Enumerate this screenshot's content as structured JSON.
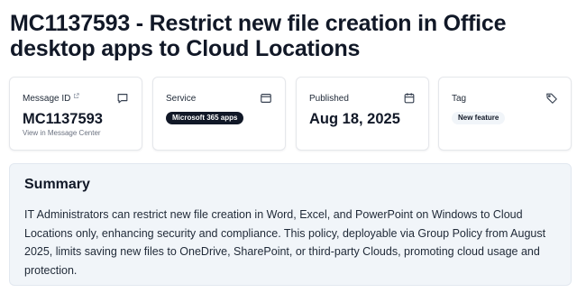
{
  "page": {
    "title": "MC1137593 - Restrict new file creation in Office desktop apps to Cloud Locations"
  },
  "cards": {
    "message_id": {
      "label": "Message ID",
      "value": "MC1137593",
      "link": "View in Message Center",
      "icon": "message-icon"
    },
    "service": {
      "label": "Service",
      "badge": "Microsoft 365 apps",
      "icon": "window-icon"
    },
    "published": {
      "label": "Published",
      "value": "Aug 18, 2025",
      "icon": "calendar-icon"
    },
    "tag": {
      "label": "Tag",
      "badge": "New feature",
      "icon": "tag-icon"
    }
  },
  "summary": {
    "heading": "Summary",
    "text": "IT Administrators can restrict new file creation in Word, Excel, and PowerPoint on Windows to Cloud Locations only, enhancing security and compliance. This policy, deployable via Group Policy from August 2025, limits saving new files to OneDrive, SharePoint, or third-party Clouds, promoting cloud usage and protection."
  },
  "colors": {
    "text_primary": "#111827",
    "badge_dark": "#111827",
    "badge_light": "#f1f5f9",
    "summary_bg": "#f1f5f9"
  }
}
